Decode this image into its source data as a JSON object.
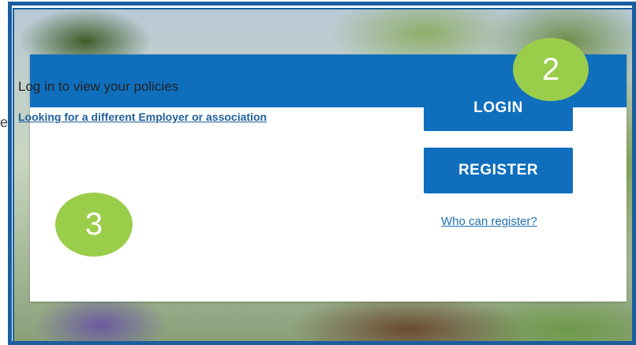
{
  "side_mark": "e",
  "card": {
    "prompt": "Log in to view your policies",
    "different_link": "Looking for a different Employer or association",
    "login_label": "LOGIN",
    "register_label": "REGISTER",
    "who_link": "Who can register?"
  },
  "annotations": {
    "badge_2": "2",
    "badge_3": "3"
  },
  "colors": {
    "primary_blue": "#0f6fbd",
    "frame_blue": "#1a5e9e",
    "badge_green": "#9acd4a",
    "link_blue": "#1f5f9a"
  }
}
